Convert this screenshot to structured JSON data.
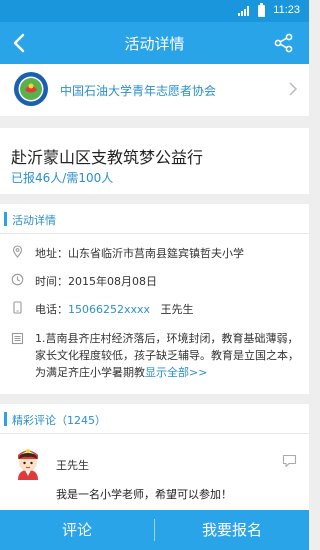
{
  "status_bar": {
    "time": "11:23"
  },
  "nav": {
    "title": "活动详情"
  },
  "organization": {
    "name": "中国石油大学青年志愿者协会"
  },
  "activity": {
    "title": "赴沂蒙山区支教筑梦公益行",
    "signup": "已报46人/需100人"
  },
  "details": {
    "section_label": "活动详情",
    "address": "地址：山东省临沂市莒南县筵宾镇哲夫小学",
    "time": "时间：2015年08月08日",
    "phone_prefix": "电话：",
    "phone_number": "15066252xxxx",
    "phone_contact": "王先生",
    "intro": "1.莒南县齐庄村经济落后，环境封闭，教育基础薄弱，家长文化程度较低，孩子缺乏辅导。教育是立国之本，为满足齐庄小学暑期教",
    "show_all": "显示全部>>"
  },
  "comments": {
    "section_label": "精彩评论（1245）",
    "items": [
      {
        "name": "王先生",
        "text": "我是一名小学老师，希望可以参加！"
      }
    ]
  },
  "bottom": {
    "comment_label": "评论",
    "signup_label": "我要报名"
  },
  "colors": {
    "primary": "#2aa4e8",
    "status_bar": "#1a96dc",
    "link": "#2a8fd0"
  },
  "icons": [
    "back-arrow-icon",
    "share-icon",
    "org-logo",
    "chevron-right-icon",
    "location-icon",
    "clock-icon",
    "phone-icon",
    "document-icon",
    "comment-bubble-icon",
    "signal-icon",
    "battery-icon"
  ]
}
